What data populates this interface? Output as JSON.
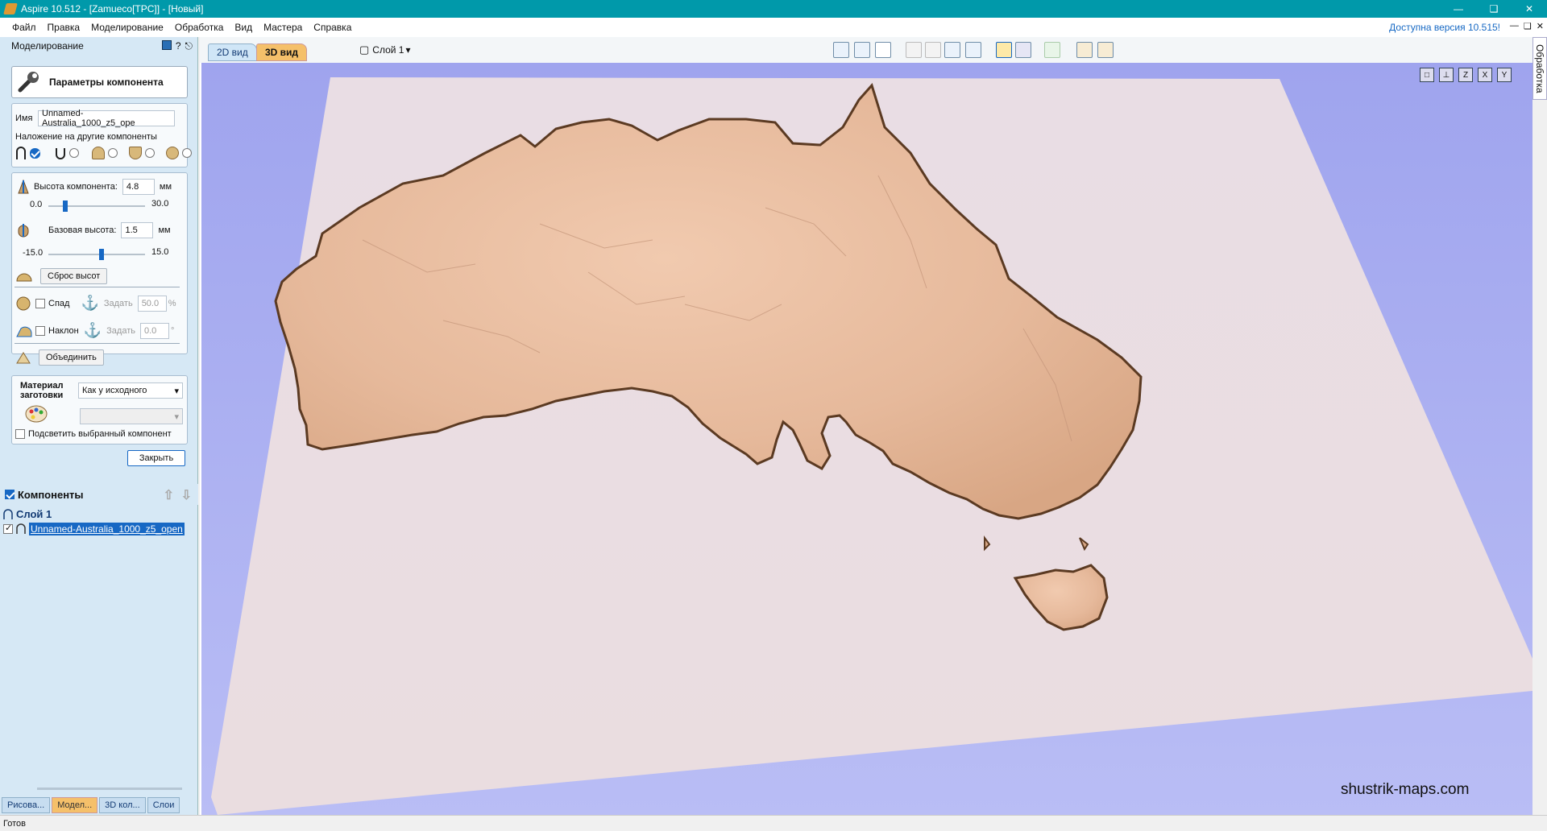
{
  "window": {
    "title": "Aspire 10.512 - [Zamueco[TPC]] - [Новый]"
  },
  "menu": {
    "items": [
      "Файл",
      "Правка",
      "Моделирование",
      "Обработка",
      "Вид",
      "Мастера",
      "Справка"
    ],
    "update_notice": "Доступна версия 10.515!"
  },
  "left_panel": {
    "header": "Моделирование",
    "params_button": "Параметры компонента",
    "name_label": "Имя",
    "name_value": "Unnamed-Australia_1000_z5_ope",
    "overlap_label": "Наложение на другие компоненты",
    "height_label": "Высота компонента:",
    "height_value": "4.8",
    "height_unit": "мм",
    "height_min": "0.0",
    "height_max": "30.0",
    "height_level": 0.16,
    "base_label": "Базовая высота:",
    "base_value": "1.5",
    "base_unit": "мм",
    "base_min": "-15.0",
    "base_max": "15.0",
    "base_level": 0.55,
    "reset_button": "Сброс высот",
    "fade_label": "Спад",
    "fade_set": "Задать",
    "fade_value": "50.0",
    "fade_unit": "%",
    "tilt_label": "Наклон",
    "tilt_set": "Задать",
    "tilt_value": "0.0",
    "tilt_unit": "°",
    "merge_button": "Объединить",
    "material_label": "Материал заготовки",
    "material_value": "Как у исходного",
    "highlight_label": "Подсветить выбранный компонент",
    "close_button": "Закрыть",
    "components_header": "Компоненты",
    "layer_name": "Слой 1",
    "component_name": "Unnamed-Australia_1000_z5_open"
  },
  "bottom_tabs": [
    "Рисова...",
    "Модел...",
    "3D кол...",
    "Слои"
  ],
  "view": {
    "tab_2d": "2D вид",
    "tab_3d": "3D вид",
    "layer": "Слой 1"
  },
  "right_tab": "Обработка",
  "watermark": "shustrik-maps.com",
  "status": "Готов",
  "colors": {
    "accent": "#0099aa",
    "selection": "#1768c4",
    "relief": "#e4b89b",
    "board": "#e8dde3"
  }
}
